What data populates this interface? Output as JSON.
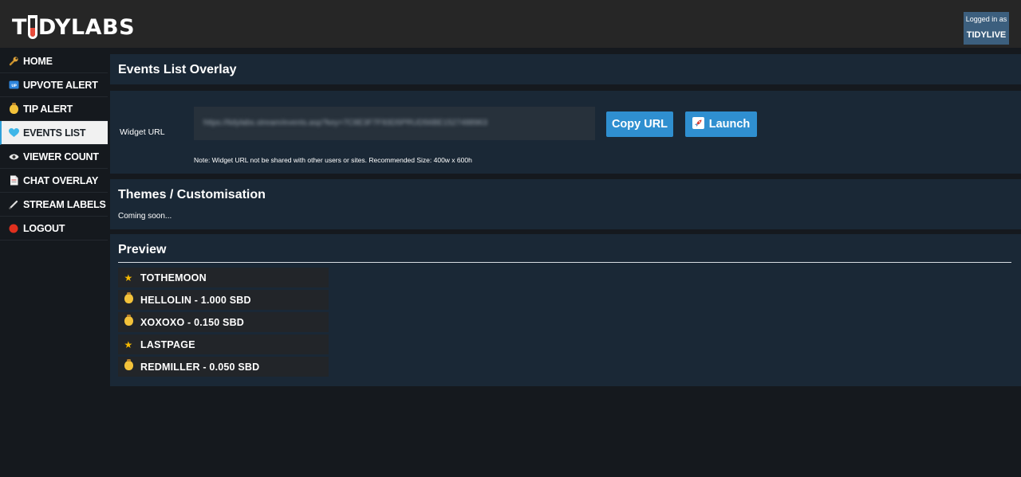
{
  "header": {
    "logo_left": "T",
    "logo_right": "DYLABS",
    "logged_in_label": "Logged in as",
    "username": "TIDYLIVE"
  },
  "sidebar": {
    "items": [
      {
        "label": "HOME",
        "icon": "wrench-icon"
      },
      {
        "label": "UPVOTE ALERT",
        "icon": "upvote-icon"
      },
      {
        "label": "TIP ALERT",
        "icon": "money-bag-icon"
      },
      {
        "label": "EVENTS LIST",
        "icon": "heart-icon"
      },
      {
        "label": "VIEWER COUNT",
        "icon": "eye-icon"
      },
      {
        "label": "CHAT OVERLAY",
        "icon": "document-icon"
      },
      {
        "label": "STREAM LABELS",
        "icon": "pencil-icon"
      },
      {
        "label": "LOGOUT",
        "icon": "red-circle-icon"
      }
    ],
    "active_index": 3
  },
  "events_overlay": {
    "title": "Events List Overlay"
  },
  "widget": {
    "label": "Widget URL",
    "url": "https://tidylabs.stream/events.asp?key=7C8E3F7F93D5PRUD56BE1527488963",
    "copy_label": "Copy URL",
    "launch_label": "Launch",
    "note": "Note: Widget URL not be shared with other users or sites. Recommended Size: 400w x 600h"
  },
  "themes": {
    "title": "Themes / Customisation",
    "status": "Coming soon..."
  },
  "preview": {
    "title": "Preview",
    "events": [
      {
        "text": "TOTHEMOON",
        "icon": "star-icon"
      },
      {
        "text": "HELLOLIN - 1.000 SBD",
        "icon": "money-bag-icon"
      },
      {
        "text": "XOXOXO - 0.150 SBD",
        "icon": "money-bag-icon"
      },
      {
        "text": "LASTPAGE",
        "icon": "star-icon"
      },
      {
        "text": "REDMILLER - 0.050 SBD",
        "icon": "money-bag-icon"
      }
    ]
  },
  "colors": {
    "background": "#15191e",
    "topbar": "#262626",
    "panel": "#1a2836",
    "accent": "#2f8fd0",
    "login_box": "#3c5f7e"
  }
}
